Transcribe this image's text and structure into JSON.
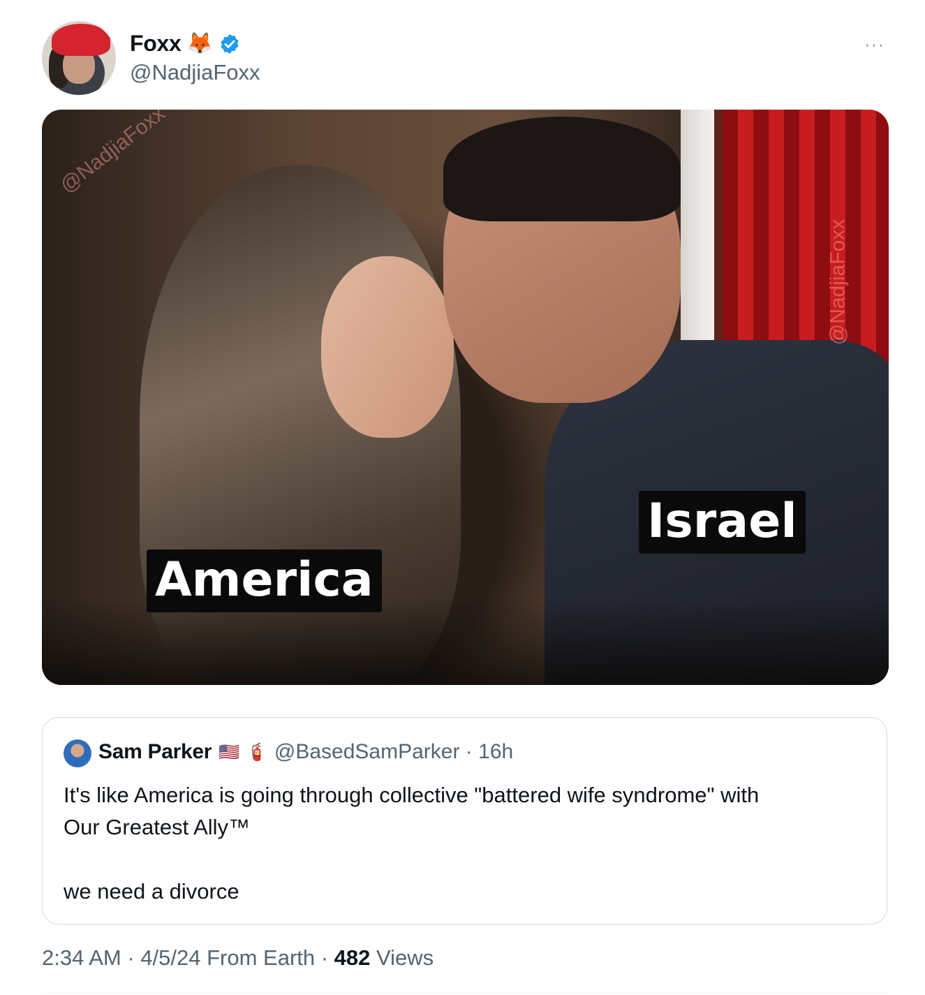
{
  "author": {
    "display_name": "Foxx",
    "emoji": "🦊",
    "handle": "@NadjiaFoxx",
    "verified_color": "#1d9bf0"
  },
  "more_label": "···",
  "media": {
    "watermark": "@NadjiaFoxx",
    "captions": {
      "left": "America",
      "right": "Israel"
    }
  },
  "quoted": {
    "display_name": "Sam Parker",
    "flag": "🇺🇸",
    "extinguisher": "🧯",
    "handle_time": "@BasedSamParker · 16h",
    "text_line1": "It's like America is going through collective \"battered wife syndrome\" with\nOur Greatest Ally™",
    "text_line2": "we need a divorce"
  },
  "meta": {
    "time_date": "2:34 AM · 4/5/24 From Earth · ",
    "views_count": "482",
    "views_label": " Views"
  }
}
